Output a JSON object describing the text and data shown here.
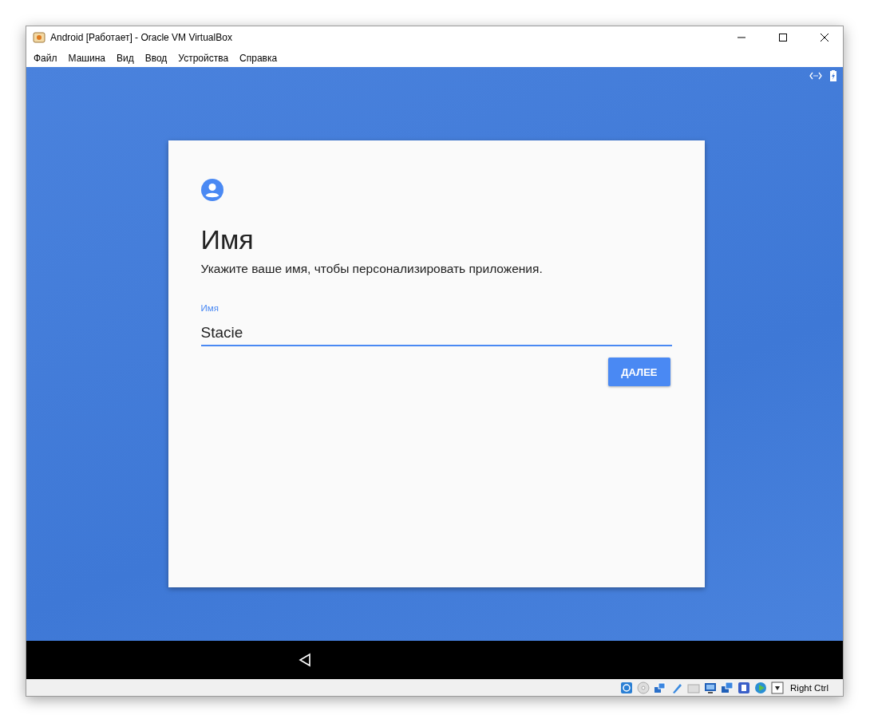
{
  "window": {
    "title": "Android [Работает] - Oracle VM VirtualBox"
  },
  "menu": [
    "Файл",
    "Машина",
    "Вид",
    "Ввод",
    "Устройства",
    "Справка"
  ],
  "card": {
    "heading": "Имя",
    "description": "Укажите ваше имя, чтобы персонализировать приложения.",
    "field": {
      "label": "Имя",
      "value": "Stacie",
      "focused": true
    },
    "next_button": "ДАЛЕЕ"
  },
  "status_bar": {
    "host_key": "Right Ctrl"
  }
}
